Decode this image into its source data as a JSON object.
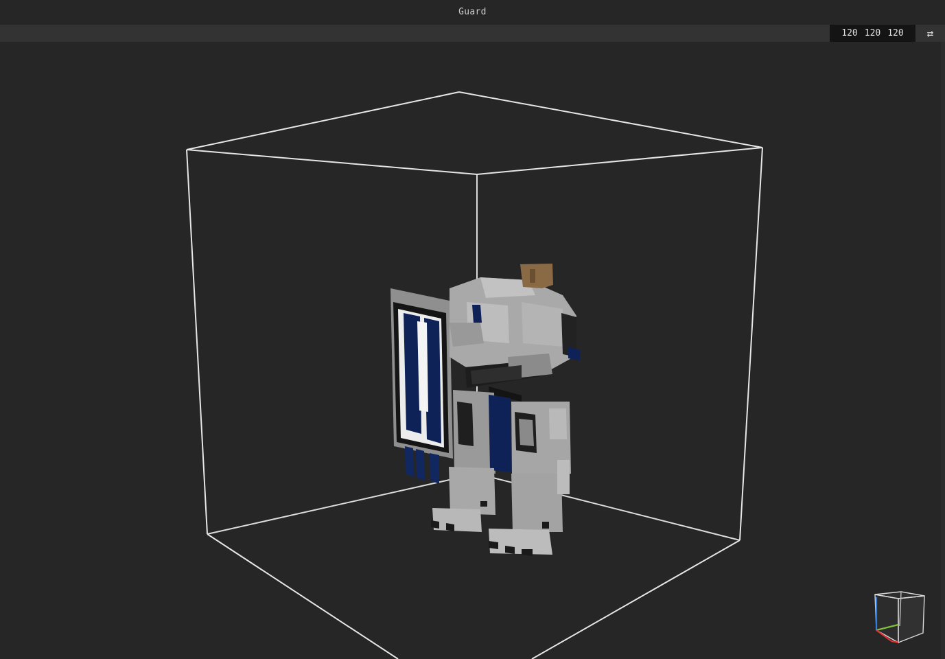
{
  "window": {
    "title": "Guard"
  },
  "toolbar": {
    "dimensions": [
      "120",
      "120",
      "120"
    ],
    "swap_icon": "swap-arrows-icon",
    "swap_glyph": "⇄"
  },
  "viewport": {
    "background_color": "#262626",
    "bounding_box_color": "#e6e6e6",
    "model": {
      "primary_color": "#a7a7a7",
      "accent_color": "#0e2257",
      "dark_color": "#1d1d1d",
      "tan_color": "#8a6a44"
    }
  },
  "nav_cube": {
    "icon": "navigation-cube-icon",
    "axis_x_color": "#e03030",
    "axis_y_color": "#7fbf3a",
    "axis_z_color": "#2f7fe0"
  }
}
